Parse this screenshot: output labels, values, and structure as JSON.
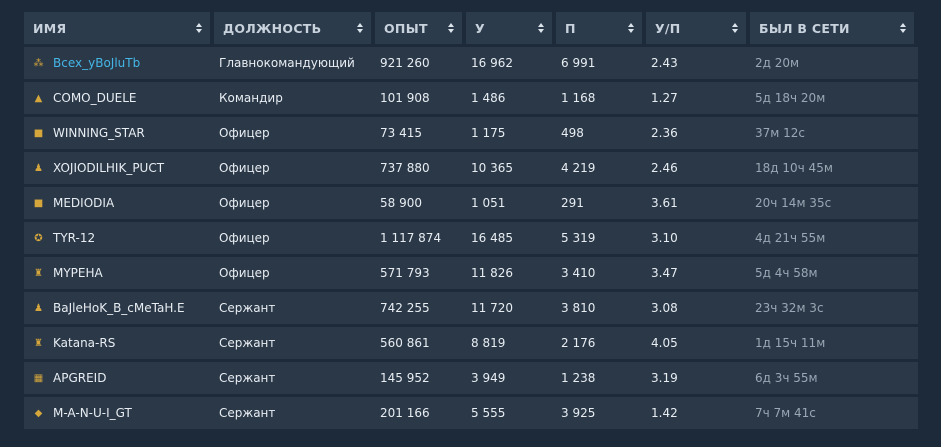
{
  "columns": [
    "ИМЯ",
    "ДОЛЖНОСТЬ",
    "ОПЫТ",
    "У",
    "П",
    "У/П",
    "БЫЛ В СЕТИ"
  ],
  "rows": [
    {
      "rank_icon": "gen-icon",
      "name": "Bcex_yBoJluTb",
      "role": "Главнокомандующий",
      "exp": "921 260",
      "kills": "16 962",
      "deaths": "6 991",
      "kd": "2.43",
      "last_seen": "2д 20м",
      "highlight": true
    },
    {
      "rank_icon": "commander-icon",
      "name": "COMO_DUELE",
      "role": "Командир",
      "exp": "101 908",
      "kills": "1 486",
      "deaths": "1 168",
      "kd": "1.27",
      "last_seen": "5д 18ч 20м"
    },
    {
      "rank_icon": "officer-icon",
      "name": "WINNING_STAR",
      "role": "Офицер",
      "exp": "73 415",
      "kills": "1 175",
      "deaths": "498",
      "kd": "2.36",
      "last_seen": "37м 12с"
    },
    {
      "rank_icon": "soldier-icon",
      "name": "XOJIODILHIK_PUCT",
      "role": "Офицер",
      "exp": "737 880",
      "kills": "10 365",
      "deaths": "4 219",
      "kd": "2.46",
      "last_seen": "18д 10ч 45м"
    },
    {
      "rank_icon": "officer-icon",
      "name": "MEDIODIA",
      "role": "Офицер",
      "exp": "58 900",
      "kills": "1 051",
      "deaths": "291",
      "kd": "3.61",
      "last_seen": "20ч 14м 35с"
    },
    {
      "rank_icon": "emblem-icon",
      "name": "TYR-12",
      "role": "Офицер",
      "exp": "1 117 874",
      "kills": "16 485",
      "deaths": "5 319",
      "kd": "3.10",
      "last_seen": "4д 21ч 55м"
    },
    {
      "rank_icon": "tower-icon",
      "name": "MYPEHA",
      "role": "Офицер",
      "exp": "571 793",
      "kills": "11 826",
      "deaths": "3 410",
      "kd": "3.47",
      "last_seen": "5д 4ч 58м"
    },
    {
      "rank_icon": "soldier-icon",
      "name": "BaJleHoK_B_cMeTaH.E",
      "role": "Сержант",
      "exp": "742 255",
      "kills": "11 720",
      "deaths": "3 810",
      "kd": "3.08",
      "last_seen": "23ч 32м 3с"
    },
    {
      "rank_icon": "tower-icon",
      "name": "Katana-RS",
      "role": "Сержант",
      "exp": "560 861",
      "kills": "8 819",
      "deaths": "2 176",
      "kd": "4.05",
      "last_seen": "1д 15ч 11м"
    },
    {
      "rank_icon": "grid-icon",
      "name": "APGREID",
      "role": "Сержант",
      "exp": "145 952",
      "kills": "3 949",
      "deaths": "1 238",
      "kd": "3.19",
      "last_seen": "6д 3ч 55м"
    },
    {
      "rank_icon": "diamond-icon",
      "name": "M-A-N-U-I_GT",
      "role": "Сержант",
      "exp": "201 166",
      "kills": "5 555",
      "deaths": "3 925",
      "kd": "1.42",
      "last_seen": "7ч 7м 41с"
    }
  ]
}
